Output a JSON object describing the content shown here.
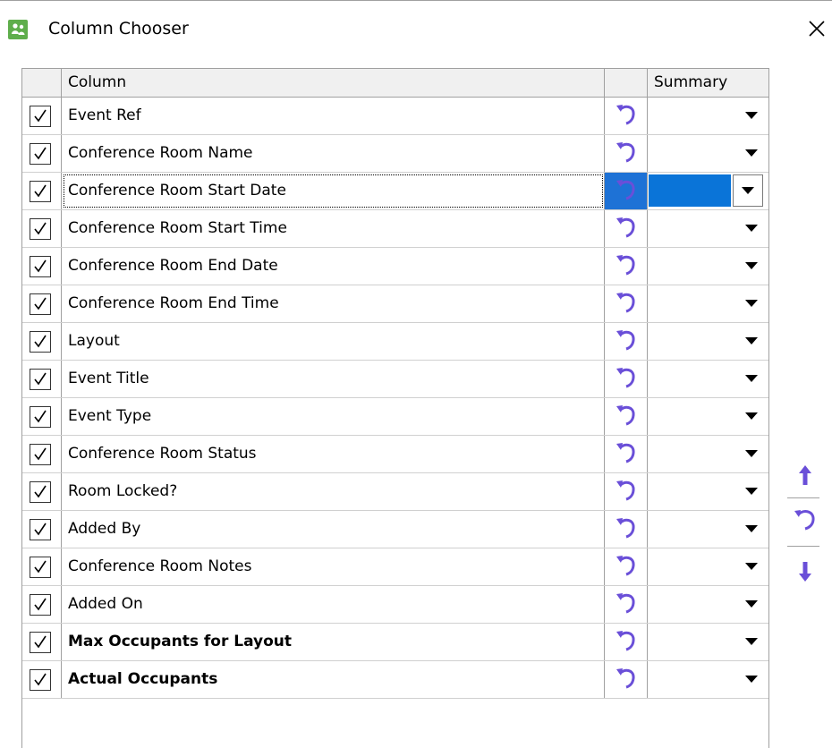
{
  "window": {
    "title": "Column Chooser",
    "icon": "app-logo-icon",
    "close_icon": "close-icon"
  },
  "grid": {
    "headers": [
      "",
      "Column",
      "",
      "Summary"
    ],
    "rows": [
      {
        "label": "Event Ref",
        "checked": true,
        "bold": false
      },
      {
        "label": "Conference Room Name",
        "checked": true,
        "bold": false
      },
      {
        "label": "Conference Room Start Date",
        "checked": true,
        "bold": false,
        "selected": true
      },
      {
        "label": "Conference Room Start Time",
        "checked": true,
        "bold": false
      },
      {
        "label": "Conference Room End Date",
        "checked": true,
        "bold": false
      },
      {
        "label": "Conference Room End Time",
        "checked": true,
        "bold": false
      },
      {
        "label": "Layout",
        "checked": true,
        "bold": false
      },
      {
        "label": "Event Title",
        "checked": true,
        "bold": false
      },
      {
        "label": "Event Type",
        "checked": true,
        "bold": false
      },
      {
        "label": "Conference Room Status",
        "checked": true,
        "bold": false
      },
      {
        "label": "Room Locked?",
        "checked": true,
        "bold": false
      },
      {
        "label": "Added By",
        "checked": true,
        "bold": false
      },
      {
        "label": "Conference Room Notes",
        "checked": true,
        "bold": false
      },
      {
        "label": "Added On",
        "checked": true,
        "bold": false
      },
      {
        "label": "Max Occupants for Layout",
        "checked": true,
        "bold": true
      },
      {
        "label": "Actual Occupants",
        "checked": true,
        "bold": true
      }
    ]
  },
  "side_buttons": [
    "move-up-icon",
    "reset-icon",
    "move-down-icon"
  ],
  "colors": {
    "accent_blue": "#0a74d8",
    "icon_purple": "#6a4fd8",
    "app_icon_green": "#5fae4c"
  }
}
